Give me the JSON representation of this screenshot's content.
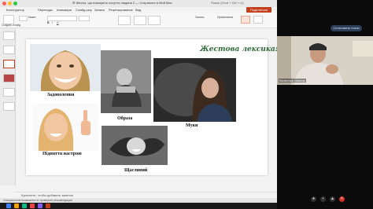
{
  "window": {
    "title": "☰ Жесты, що показують почуття людини 2 — Сохранено в Мой Mac",
    "search": "Поиск (Cmd + Ctrl + U)"
  },
  "ribbon_tabs": [
    "Конструктор",
    "Переходы",
    "Анимация",
    "Слайд-шоу",
    "Запись",
    "Рецензирование",
    "Вид"
  ],
  "ribbon_tools": {
    "create": "Создать слайд",
    "layout": "Макет",
    "font": "Шрифты",
    "comment": "Запись",
    "present": "Примечания",
    "share": "Поделиться"
  },
  "slide": {
    "title": "Жестова лексика:",
    "captions": {
      "happy": "Задоволення",
      "hurt": "Образа",
      "torment": "Муки",
      "mood": "Підняття настрою",
      "joyful": "Щасливий"
    }
  },
  "notes_placeholder": "Щелкните, чтобы добавить заметки",
  "status": "Специальные возможности: проверьте рекомендации",
  "meet": {
    "button": "Остановить показ",
    "participant_name": "Вячеслав Иванов"
  },
  "colors": {
    "accent": "#c43e1c",
    "title_green": "#2f6b3a"
  }
}
